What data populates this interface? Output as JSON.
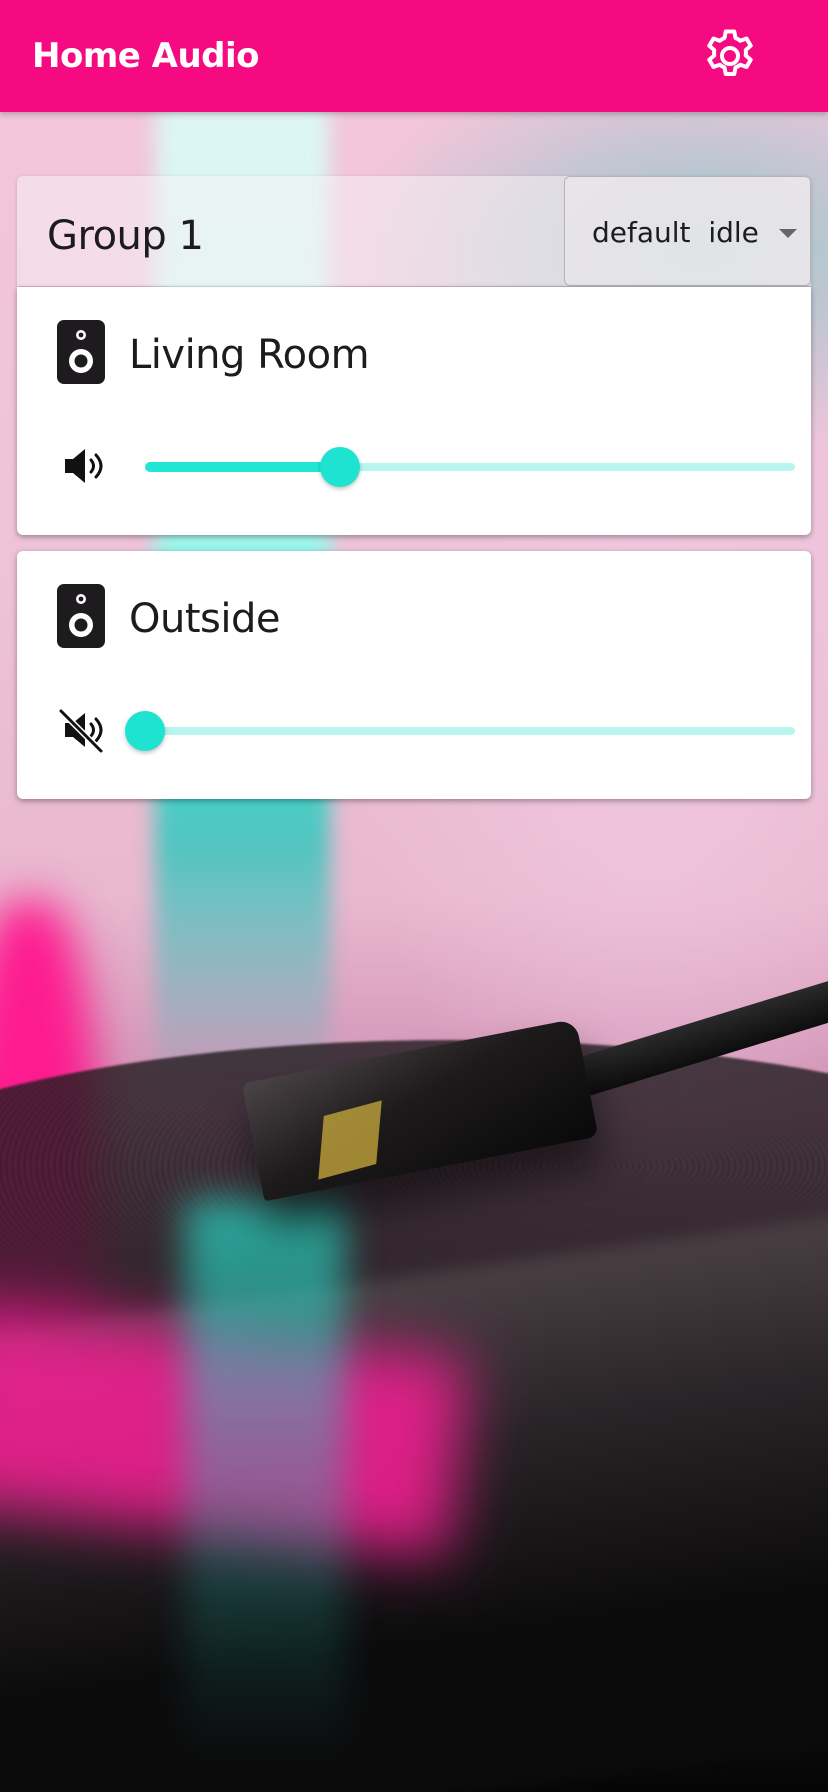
{
  "app": {
    "title": "Home Audio",
    "accent_color": "#f50a82",
    "slider_color": "#1de3d0",
    "settings_icon": "gear-icon"
  },
  "group": {
    "title": "Group 1",
    "select_value": "default  idle"
  },
  "zones": [
    {
      "name": "Living Room",
      "icon": "speaker-icon",
      "volume_icon": "volume-up-icon",
      "muted": false,
      "volume": 0.3
    },
    {
      "name": "Outside",
      "icon": "speaker-icon",
      "volume_icon": "volume-mute-icon",
      "muted": true,
      "volume": 0.0
    }
  ]
}
